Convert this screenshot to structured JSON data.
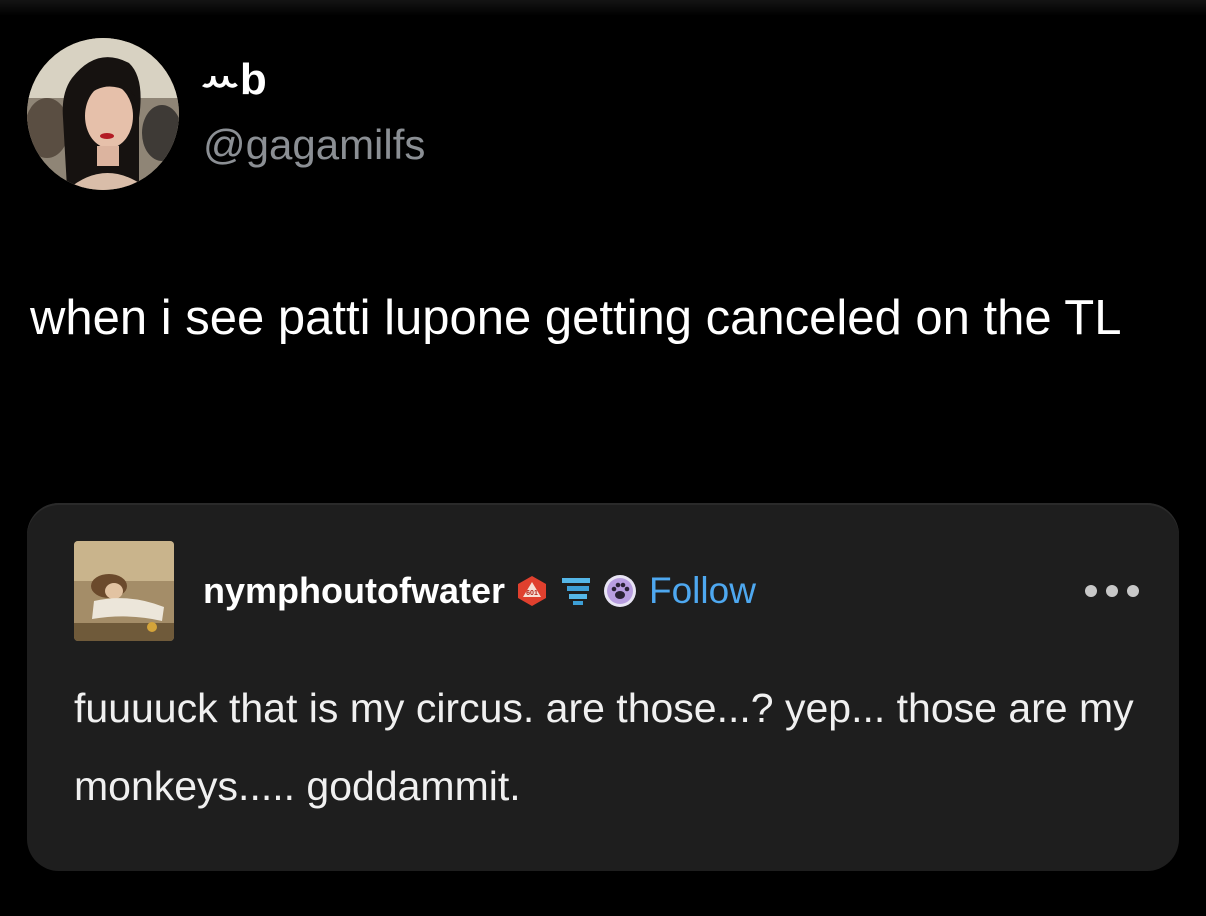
{
  "tweet": {
    "display_name": "ꕀb",
    "handle": "@gagamilfs",
    "text": "when i see patti lupone getting canceled on the TL",
    "avatar_icon": "profile-photo-icon"
  },
  "quoted_post": {
    "username": "nymphoutofwater",
    "follow_label": "Follow",
    "text": "fuuuuck that is my circus. are those...? yep... those are my monkeys..... goddammit.",
    "avatar_icon": "painting-avatar-icon",
    "badges": [
      "d20-dice-badge-icon",
      "blue-flag-badge-icon",
      "paw-badge-icon"
    ],
    "more_icon": "more-options-icon"
  },
  "colors": {
    "background": "#000000",
    "card_background": "#1e1e1e",
    "handle_gray": "#8b8f94",
    "follow_blue": "#4ea8f0"
  }
}
